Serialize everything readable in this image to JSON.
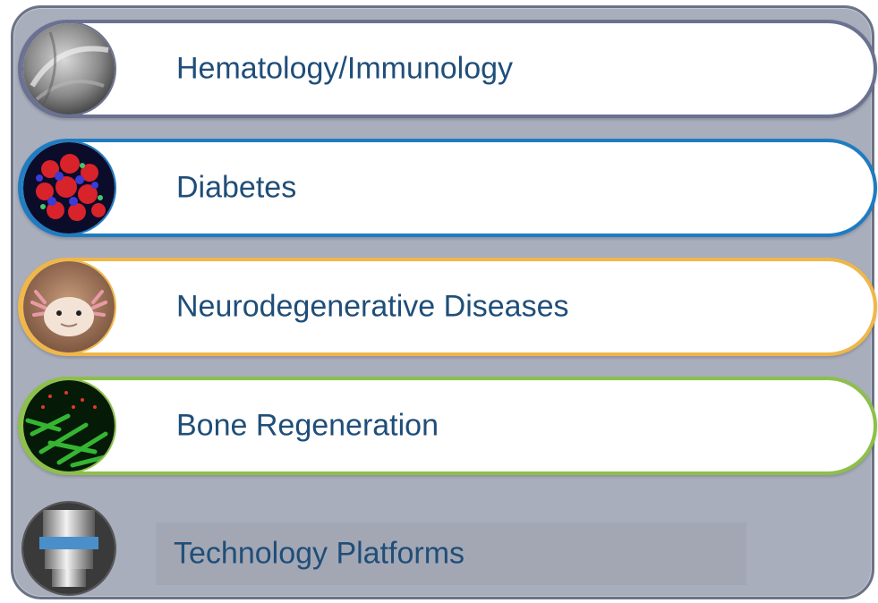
{
  "items": [
    {
      "label": "Hematology/Immunology",
      "image": "red-blood-cell-micrograph-icon"
    },
    {
      "label": "Diabetes",
      "image": "islet-cells-fluorescence-icon"
    },
    {
      "label": "Neurodegenerative Diseases",
      "image": "axolotl-icon"
    },
    {
      "label": "Bone Regeneration",
      "image": "green-cells-fluorescence-icon"
    },
    {
      "label": "Technology Platforms",
      "image": "microscope-objective-icon"
    }
  ],
  "colors": {
    "panel_background": "#a9aebd",
    "text": "#1f4e79",
    "hematology_border": "#6b7190",
    "diabetes_border": "#1f7cc0",
    "neuro_border": "#efb74a",
    "bone_border": "#8dc04a"
  }
}
